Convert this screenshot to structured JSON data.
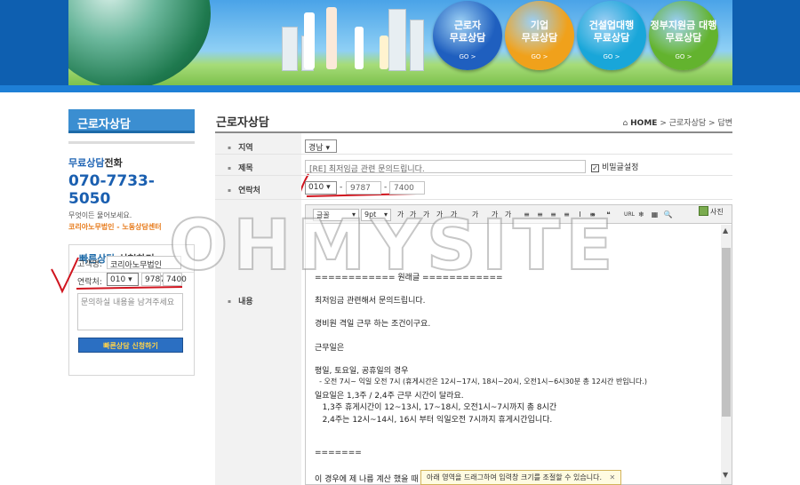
{
  "banner": {
    "circles": [
      {
        "line1": "근로자",
        "line2": "무료상담",
        "go": "GO >",
        "color": "#1f5fbf"
      },
      {
        "line1": "기업",
        "line2": "무료상담",
        "go": "GO >",
        "color": "#f0a11b"
      },
      {
        "line1": "건설업대행",
        "line2": "무료상담",
        "go": "GO >",
        "color": "#19a6d9"
      },
      {
        "line1": "정부지원금 대행",
        "line2": "무료상담",
        "go": "GO >",
        "color": "#63b32e"
      }
    ]
  },
  "sidebar": {
    "heading": "근로자상담",
    "free_bold": "무료상담",
    "free_rest": "전화",
    "phone": "070-7733-5050",
    "note": "무엇이든 물어보세요.",
    "org": "코리아노무법인 - 노동상담센터",
    "quick": {
      "title_bold": "빠른상담",
      "title_rest": " 신청하기",
      "name_label": "고객명:",
      "name_value": "코리아노무법인",
      "phone_label": "연락처:",
      "phone_prefix": "010",
      "phone_mid": "9787",
      "phone_last": "7400",
      "message_placeholder": "문의하실 내용을 남겨주세요",
      "submit_label": "빠른상담 신청하기"
    }
  },
  "main": {
    "title": "근로자상담",
    "breadcrumb": {
      "home": "HOME",
      "sep1": ">",
      "item1": "근로자상담",
      "sep2": ">",
      "item2": "답변"
    },
    "form": {
      "region_label": "지역",
      "region_value": "경남",
      "subject_label": "제목",
      "subject_value": "[RE] 최저임금 관련 문의드립니다.",
      "secret_label": "비밀글설정",
      "contact_label": "연락처",
      "contact_prefix": "010",
      "contact_mid": "9787",
      "contact_last": "7400",
      "dash": "-",
      "content_label": "내용"
    },
    "toolbar": {
      "font": "글꼴",
      "size": "9pt",
      "buttons": [
        "가",
        "가",
        "가",
        "가",
        "가",
        "가",
        "가",
        "가",
        "≡",
        "≡",
        "≡",
        "≡",
        "I",
        "≡",
        "»",
        "❝",
        "URL",
        "❄",
        "▦",
        "🔍"
      ],
      "photo_label": "사진"
    },
    "editor_lines": [
      "============ 원래글 ============",
      "최저임금 관련해서 문의드립니다.",
      "경비원 격일 근무 하는 조건이구요.",
      "근무일은",
      "평일, 토요일, 공휴일의 경우",
      "  - 오전 7시~ 익일 오전 7시 (휴게시간은 12시~17시, 18시~20시, 오전1시~6시30분 총 12시간 반입니다.)",
      "일요일은 1,3주 / 2,4주 근무 시간이 달라요.",
      "   1,3주 휴게시간이 12~13시, 17~18시, 오전1시~7시까지 총 8시간",
      "   2,4주는 12시~14시, 16시 부터 익일오전 7시까지 휴게시간입니다.",
      "=======",
      "이 경우에 제 나름 계산 했을 때"
    ],
    "tooltip": "아래 영역을 드래그하여 입력창 크기를 조절할 수 있습니다.",
    "tooltip_close": "✕"
  },
  "watermark": "OHMYSITE"
}
